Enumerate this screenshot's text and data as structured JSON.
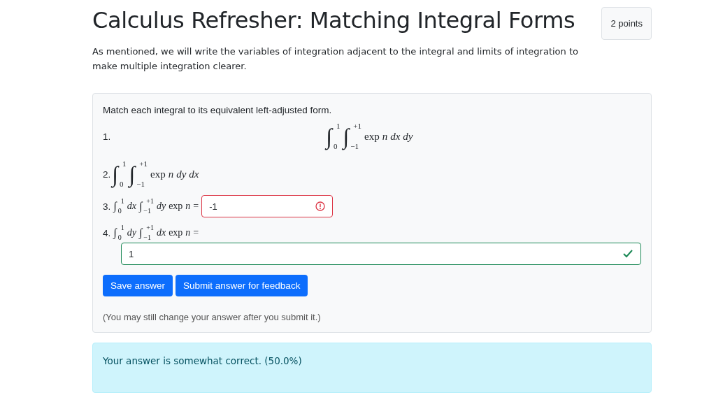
{
  "title": "Calculus Refresher: Matching Integral Forms",
  "points": "2 points",
  "intro": "As mentioned, we will write the variables of integration adjacent to the integral and limits of integration to make multiple integration clearer.",
  "question": {
    "prompt": "Match each integral to its equivalent left-adjusted form.",
    "items": [
      {
        "number": "1.",
        "kind": "centered",
        "math": [
          {
            "kind": "int",
            "sign": "∫",
            "lower": "0",
            "upper": "1"
          },
          {
            "kind": "int",
            "sign": "∫",
            "lower": "−1",
            "upper": "+1"
          },
          {
            "kind": "op",
            "text": "exp"
          },
          {
            "kind": "var",
            "text": "n"
          },
          {
            "kind": "var",
            "text": "dx"
          },
          {
            "kind": "var",
            "text": "dy"
          }
        ]
      },
      {
        "number": "2.",
        "kind": "large",
        "math": [
          {
            "kind": "int",
            "sign": "∫",
            "lower": "0",
            "upper": "1"
          },
          {
            "kind": "int",
            "sign": "∫",
            "lower": "−1",
            "upper": "+1"
          },
          {
            "kind": "op",
            "text": "exp"
          },
          {
            "kind": "var",
            "text": "n"
          },
          {
            "kind": "var",
            "text": "dy"
          },
          {
            "kind": "var",
            "text": "dx"
          }
        ]
      },
      {
        "number": "3.",
        "kind": "inline",
        "math": [
          {
            "kind": "int",
            "sign": "∫",
            "lower": "0",
            "upper": "1"
          },
          {
            "kind": "var",
            "text": "dx"
          },
          {
            "kind": "int",
            "sign": "∫",
            "lower": "−1",
            "upper": "+1"
          },
          {
            "kind": "var",
            "text": "dy"
          },
          {
            "kind": "op",
            "text": "exp"
          },
          {
            "kind": "var",
            "text": "n"
          },
          {
            "kind": "op",
            "text": "="
          }
        ],
        "answer": {
          "value": "-1",
          "correct": false
        }
      },
      {
        "number": "4.",
        "kind": "stacked",
        "math": [
          {
            "kind": "int",
            "sign": "∫",
            "lower": "0",
            "upper": "1"
          },
          {
            "kind": "var",
            "text": "dy"
          },
          {
            "kind": "int",
            "sign": "∫",
            "lower": "−1",
            "upper": "+1"
          },
          {
            "kind": "var",
            "text": "dx"
          },
          {
            "kind": "op",
            "text": "exp"
          },
          {
            "kind": "var",
            "text": "n"
          },
          {
            "kind": "op",
            "text": "="
          }
        ],
        "answer": {
          "value": "1",
          "correct": true
        }
      }
    ],
    "buttons": [
      "Save answer",
      "Submit answer for feedback"
    ],
    "note": "(You may still change your answer after you submit it.)"
  },
  "feedback": "Your answer is somewhat correct. (50.0%)"
}
